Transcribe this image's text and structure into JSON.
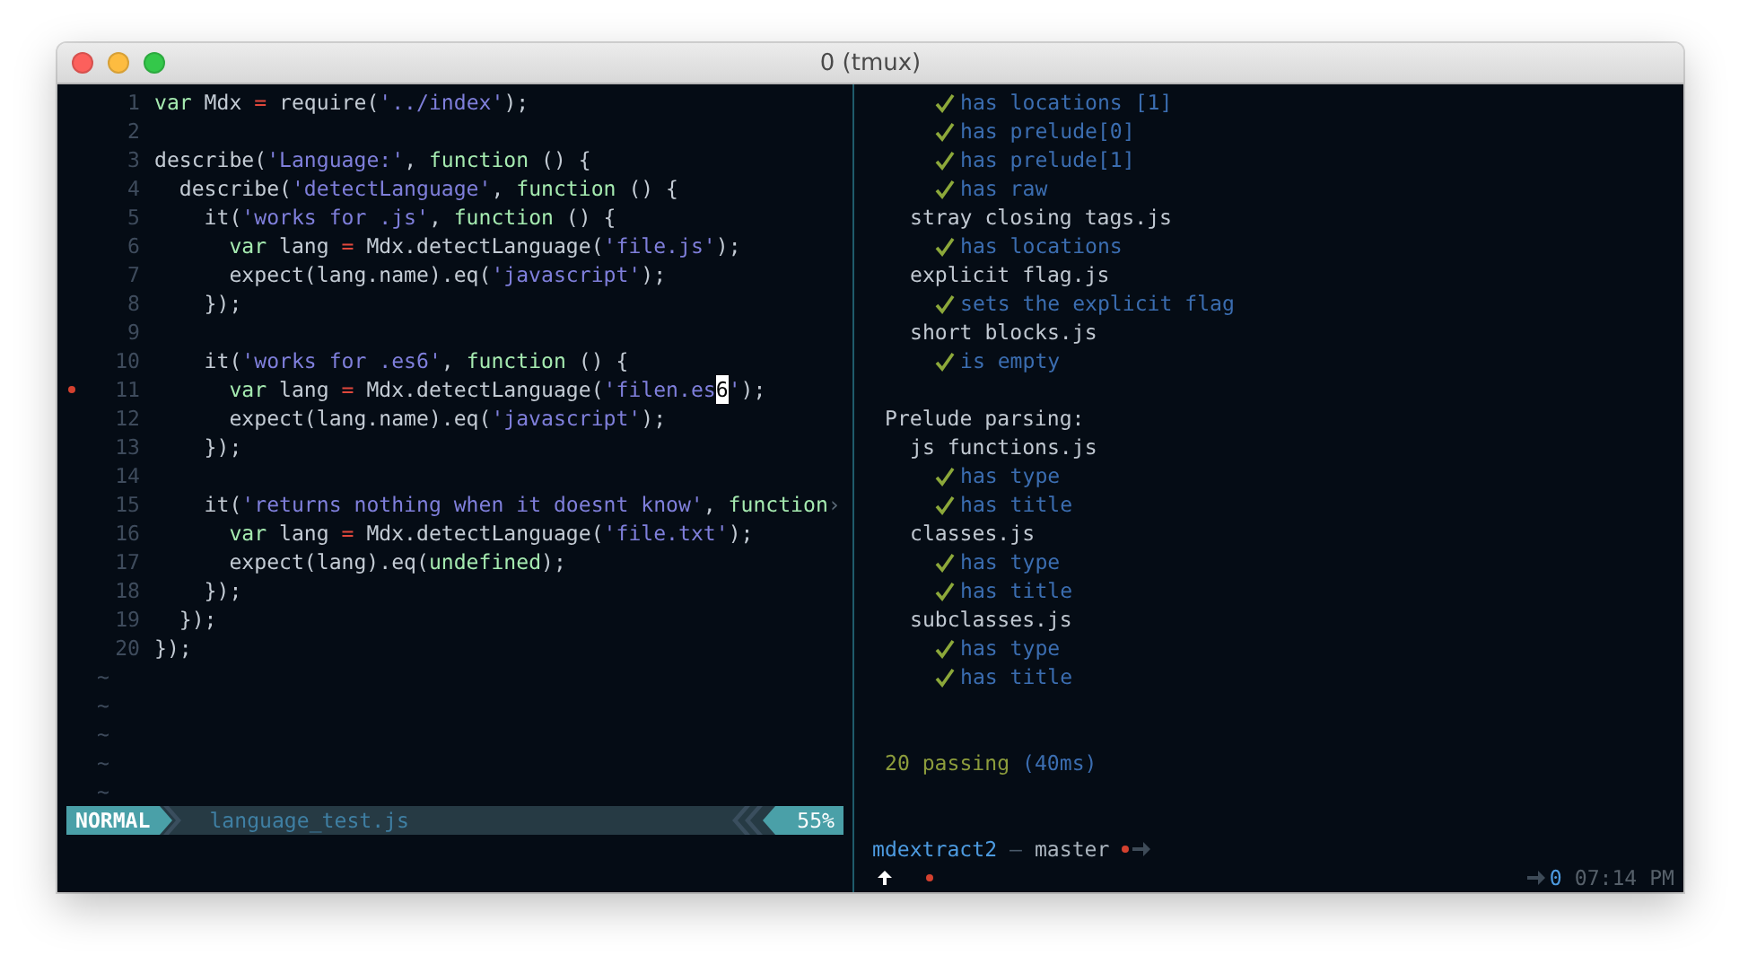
{
  "window": {
    "title": "0 (tmux)"
  },
  "editor": {
    "lines": [
      {
        "number": "1",
        "tokens": [
          {
            "text": "var",
            "kind": "keyword"
          },
          {
            "text": " Mdx ",
            "kind": "plain"
          },
          {
            "text": "=",
            "kind": "operator"
          },
          {
            "text": " require(",
            "kind": "plain"
          },
          {
            "text": "'../index'",
            "kind": "string"
          },
          {
            "text": ");",
            "kind": "plain"
          }
        ]
      },
      {
        "number": "2"
      },
      {
        "number": "3",
        "tokens": [
          {
            "text": "describe(",
            "kind": "plain"
          },
          {
            "text": "'Language:'",
            "kind": "string"
          },
          {
            "text": ", ",
            "kind": "plain"
          },
          {
            "text": "function",
            "kind": "keyword"
          },
          {
            "text": " () {",
            "kind": "plain"
          }
        ]
      },
      {
        "number": "4",
        "tokens": [
          {
            "text": "  describe(",
            "kind": "plain"
          },
          {
            "text": "'detectLanguage'",
            "kind": "string"
          },
          {
            "text": ", ",
            "kind": "plain"
          },
          {
            "text": "function",
            "kind": "keyword"
          },
          {
            "text": " () {",
            "kind": "plain"
          }
        ]
      },
      {
        "number": "5",
        "tokens": [
          {
            "text": "    it(",
            "kind": "plain"
          },
          {
            "text": "'works for .js'",
            "kind": "string"
          },
          {
            "text": ", ",
            "kind": "plain"
          },
          {
            "text": "function",
            "kind": "keyword"
          },
          {
            "text": " () {",
            "kind": "plain"
          }
        ]
      },
      {
        "number": "6",
        "tokens": [
          {
            "text": "      var",
            "kind": "keyword"
          },
          {
            "text": " lang ",
            "kind": "plain"
          },
          {
            "text": "=",
            "kind": "operator"
          },
          {
            "text": " Mdx.detectLanguage(",
            "kind": "plain"
          },
          {
            "text": "'file.js'",
            "kind": "string"
          },
          {
            "text": ");",
            "kind": "plain"
          }
        ]
      },
      {
        "number": "7",
        "tokens": [
          {
            "text": "      expect(lang.name).eq(",
            "kind": "plain"
          },
          {
            "text": "'javascript'",
            "kind": "string"
          },
          {
            "text": ");",
            "kind": "plain"
          }
        ]
      },
      {
        "number": "8",
        "tokens": [
          {
            "text": "    });",
            "kind": "plain"
          }
        ]
      },
      {
        "number": "9"
      },
      {
        "number": "10",
        "tokens": [
          {
            "text": "    it(",
            "kind": "plain"
          },
          {
            "text": "'works for .es6'",
            "kind": "string"
          },
          {
            "text": ", ",
            "kind": "plain"
          },
          {
            "text": "function",
            "kind": "keyword"
          },
          {
            "text": " () {",
            "kind": "plain"
          }
        ]
      },
      {
        "number": "11",
        "error_sign": true,
        "tokens": [
          {
            "text": "      var",
            "kind": "keyword"
          },
          {
            "text": " lang ",
            "kind": "plain"
          },
          {
            "text": "=",
            "kind": "operator"
          },
          {
            "text": " Mdx.detectLanguage(",
            "kind": "plain"
          },
          {
            "text": "'filen.es",
            "kind": "string"
          },
          {
            "text": "6",
            "kind": "string",
            "cursor": true
          },
          {
            "text": "'",
            "kind": "string"
          },
          {
            "text": ");",
            "kind": "plain"
          }
        ]
      },
      {
        "number": "12",
        "tokens": [
          {
            "text": "      expect(lang.name).eq(",
            "kind": "plain"
          },
          {
            "text": "'javascript'",
            "kind": "string"
          },
          {
            "text": ");",
            "kind": "plain"
          }
        ]
      },
      {
        "number": "13",
        "tokens": [
          {
            "text": "    });",
            "kind": "plain"
          }
        ]
      },
      {
        "number": "14"
      },
      {
        "number": "15",
        "tokens": [
          {
            "text": "    it(",
            "kind": "plain"
          },
          {
            "text": "'returns nothing when it doesnt know'",
            "kind": "string"
          },
          {
            "text": ", ",
            "kind": "plain"
          },
          {
            "text": "function",
            "kind": "keyword"
          },
          {
            "text": "›",
            "kind": "marker"
          }
        ]
      },
      {
        "number": "16",
        "tokens": [
          {
            "text": "      var",
            "kind": "keyword"
          },
          {
            "text": " lang ",
            "kind": "plain"
          },
          {
            "text": "=",
            "kind": "operator"
          },
          {
            "text": " Mdx.detectLanguage(",
            "kind": "plain"
          },
          {
            "text": "'file.txt'",
            "kind": "string"
          },
          {
            "text": ");",
            "kind": "plain"
          }
        ]
      },
      {
        "number": "17",
        "tokens": [
          {
            "text": "      expect(lang).eq(",
            "kind": "plain"
          },
          {
            "text": "undefined",
            "kind": "keyword"
          },
          {
            "text": ");",
            "kind": "plain"
          }
        ]
      },
      {
        "number": "18",
        "tokens": [
          {
            "text": "    });",
            "kind": "plain"
          }
        ]
      },
      {
        "number": "19",
        "tokens": [
          {
            "text": "  });",
            "kind": "plain"
          }
        ]
      },
      {
        "number": "20",
        "tokens": [
          {
            "text": "});",
            "kind": "plain"
          }
        ]
      }
    ],
    "empty_lines": [
      "~",
      "~",
      "~",
      "~",
      "~"
    ],
    "status_line": {
      "mode": "NORMAL",
      "file": "language_test.js",
      "percent": "55%"
    }
  },
  "test_output": {
    "sections": [
      {
        "suites": [
          {
            "tests": [
              "has locations [1]",
              "has prelude[0]",
              "has prelude[1]",
              "has raw"
            ]
          },
          {
            "title": "stray closing tags.js",
            "tests": [
              "has locations"
            ]
          },
          {
            "title": "explicit flag.js",
            "tests": [
              "sets the explicit flag"
            ]
          },
          {
            "title": "short blocks.js",
            "tests": [
              "is empty"
            ]
          }
        ]
      },
      {
        "title": "Prelude parsing:",
        "suites": [
          {
            "title": "js functions.js",
            "tests": [
              "has type",
              "has title"
            ]
          },
          {
            "title": "classes.js",
            "tests": [
              "has type",
              "has title"
            ]
          },
          {
            "title": "subclasses.js",
            "tests": [
              "has type",
              "has title"
            ]
          }
        ]
      }
    ],
    "summary": {
      "passing": "20 passing",
      "duration": "(40ms)"
    }
  },
  "prompt": {
    "directory": "mdextract2",
    "separator": "—",
    "branch": "master",
    "dirty": true
  },
  "tmux_status": {
    "windows": "0",
    "time": "07:14 PM"
  }
}
